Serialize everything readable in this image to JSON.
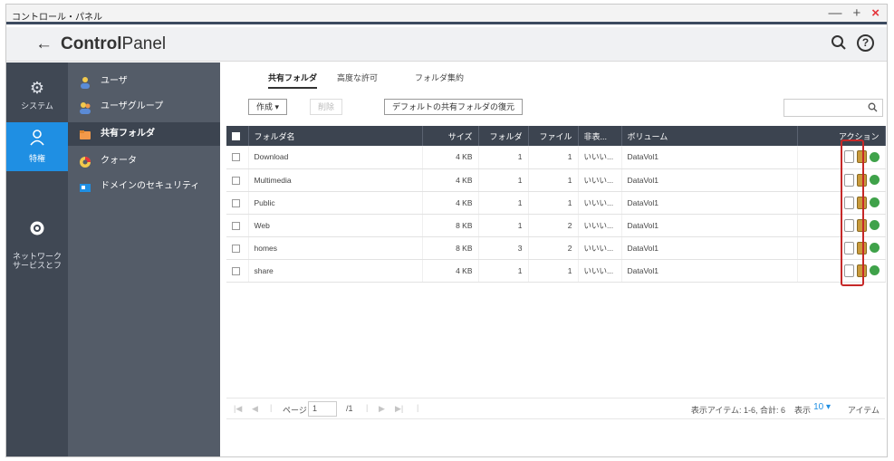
{
  "window": {
    "title": "コントロール・パネル",
    "minimize": "—",
    "maximize": "+",
    "close": "×"
  },
  "header": {
    "back": "←",
    "title_bold": "Control",
    "title_rest": "Panel",
    "search_icon": "search-icon",
    "help_icon": "?"
  },
  "rail": {
    "items": [
      {
        "label": "システム",
        "icon": "gear-icon"
      },
      {
        "label": "特権",
        "icon": "user-icon"
      },
      {
        "label": "ネットワーク\nサービスとフ",
        "icon": "network-icon"
      }
    ]
  },
  "subnav": {
    "items": [
      {
        "label": "ユーザ",
        "icon": "user-icon"
      },
      {
        "label": "ユーザグループ",
        "icon": "user-group-icon"
      },
      {
        "label": "共有フォルダ",
        "icon": "folder-icon"
      },
      {
        "label": "クォータ",
        "icon": "quota-icon"
      },
      {
        "label": "ドメインのセキュリティ",
        "icon": "domain-icon"
      }
    ]
  },
  "tabs": [
    {
      "label": "共有フォルダ"
    },
    {
      "label": "高度な許可"
    },
    {
      "label": "フォルダ集約"
    }
  ],
  "toolbar": {
    "create": "作成 ▾",
    "delete": "削除",
    "restore": "デフォルトの共有フォルダの復元"
  },
  "table": {
    "headers": [
      "",
      "フォルダ名",
      "サイズ",
      "フォルダ",
      "ファイル",
      "非表...",
      "ボリューム",
      "アクション"
    ],
    "rows": [
      {
        "name": "Download",
        "size": "4 KB",
        "folders": "1",
        "files": "1",
        "hidden": "いいい...",
        "volume": "DataVol1"
      },
      {
        "name": "Multimedia",
        "size": "4 KB",
        "folders": "1",
        "files": "1",
        "hidden": "いいい...",
        "volume": "DataVol1"
      },
      {
        "name": "Public",
        "size": "4 KB",
        "folders": "1",
        "files": "1",
        "hidden": "いいい...",
        "volume": "DataVol1"
      },
      {
        "name": "Web",
        "size": "8 KB",
        "folders": "1",
        "files": "2",
        "hidden": "いいい...",
        "volume": "DataVol1"
      },
      {
        "name": "homes",
        "size": "8 KB",
        "folders": "3",
        "files": "2",
        "hidden": "いいい...",
        "volume": "DataVol1"
      },
      {
        "name": "share",
        "size": "4 KB",
        "folders": "1",
        "files": "1",
        "hidden": "いいい...",
        "volume": "DataVol1"
      }
    ]
  },
  "pager": {
    "first": "|◀",
    "prev": "◀",
    "page_label": "ページ",
    "page_value": "1",
    "page_total": "/1",
    "next": "▶",
    "last": "▶|",
    "summary": "表示アイテム: 1-6, 合計: 6",
    "show": "表示",
    "count": "10 ▾",
    "items": "アイテム"
  },
  "colors": {
    "accent": "#1f8fe3",
    "rail_bg": "#404854",
    "subnav_bg": "#545c68",
    "highlight": "#c62828"
  }
}
